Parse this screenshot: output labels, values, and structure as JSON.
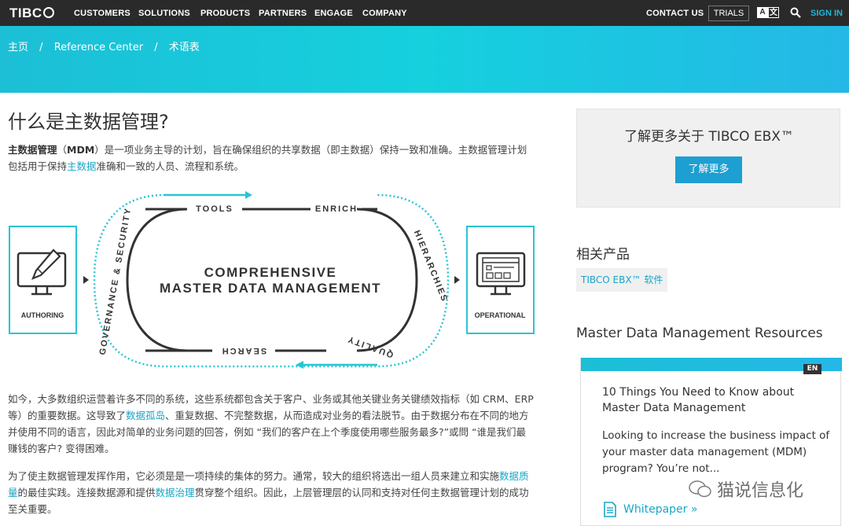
{
  "nav": {
    "logo": "TIBC",
    "items": [
      "CUSTOMERS",
      "SOLUTIONS",
      "PRODUCTS",
      "PARTNERS",
      "ENGAGE",
      "COMPANY"
    ],
    "contact": "CONTACT US",
    "trials": "TRIALS",
    "lang_a": "A",
    "lang_b": "文",
    "signin": "SIGN IN"
  },
  "breadcrumb": [
    "主页",
    "/",
    "Reference Center",
    "/",
    "术语表"
  ],
  "page_title": "什么是主数据管理?",
  "intro": {
    "bold": "主数据管理",
    "part1": "（",
    "mdm": "MDM",
    "part2": "）是一项业务主导的计划，旨在确保组织的共享数据（即主数据）保持一致和准确。主数据管理计划包括用于保持",
    "link": "主数据",
    "part3": "准确和一致的人员、流程和系统。"
  },
  "diagram": {
    "left_label": "AUTHORING",
    "right_label": "OPERATIONAL",
    "center_line1": "COMPREHENSIVE",
    "center_line2": "MASTER DATA MANAGEMENT",
    "tools": "TOOLS",
    "enrich": "ENRICH",
    "hierarchies": "HIERARCHIES",
    "quality": "QUALITY",
    "search": "SEARCH",
    "governance": "GOVERNANCE & SECURITY",
    "accent": "#2ac4d2"
  },
  "para2": {
    "t1": "如今，大多数组织运营着许多不同的系统，这些系统都包含关于客户、业务或其他关键业务关键绩效指标（如 CRM、ERP 等）的重要数据。这导致了",
    "link": "数据孤岛",
    "t2": "、重复数据、不完整数据，从而造成对业务的看法脱节。由于数据分布在不同的地方并使用不同的语言，因此对简单的业务问题的回答，例如 “我们的客户在上个季度使用哪些服务最多?”或問 “谁是我们最赚钱的客户? 变得困难。"
  },
  "para3": {
    "t1": "为了使主数据管理发挥作用，它必须是是一项持续的集体的努力。通常，较大的组织将选出一组人员来建立和实施",
    "link1": "数据质量",
    "t2": "的最佳实践。连接数据源和提供",
    "link2": "数据治理",
    "t3": "贯穿整个组织。因此，上层管理层的认同和支持对任何主数据管理计划的成功至关重要。"
  },
  "sidebar": {
    "promo_title": "了解更多关于 TIBCO EBX™",
    "promo_button": "了解更多",
    "related_heading": "相关产品",
    "related_tag": "TIBCO EBX™ 软件",
    "resources_heading": "Master Data Management Resources",
    "card": {
      "lang": "EN",
      "title": "10 Things You Need to Know about Master Data Management",
      "desc": "Looking to increase the business impact of your master data management (MDM) program? You’re not...",
      "link": "Whitepaper »"
    }
  },
  "watermark": "猫说信息化"
}
